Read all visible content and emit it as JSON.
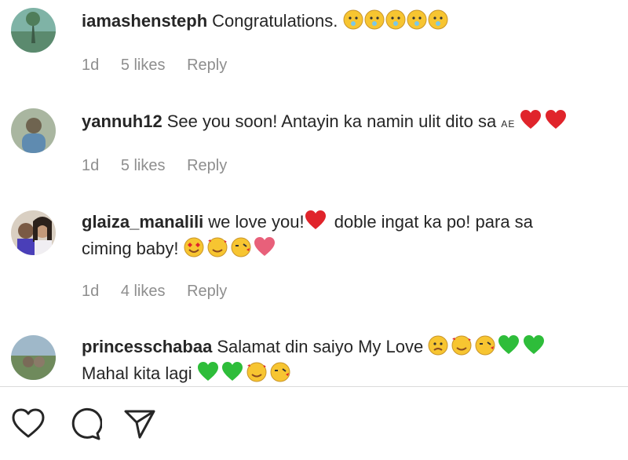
{
  "comments": [
    {
      "username": "iamashensteph",
      "text": "Congratulations.",
      "time": "1d",
      "likes": "5 likes",
      "reply": "Reply"
    },
    {
      "username": "yannuh12",
      "text": "See you soon! Antayin ka namin ulit dito sa",
      "small_text": "AE",
      "time": "1d",
      "likes": "5 likes",
      "reply": "Reply"
    },
    {
      "username": "glaiza_manalili",
      "text": "we love you!",
      "text2": "doble ingat ka po! para sa",
      "text3": "ciming baby!",
      "time": "1d",
      "likes": "4 likes",
      "reply": "Reply"
    },
    {
      "username": "princesschabaa",
      "text": "Salamat din saiyo My Love",
      "text2": "Mahal kita lagi"
    }
  ],
  "actions": {
    "like_icon": "heart-outline-icon",
    "comment_icon": "comment-bubble-icon",
    "share_icon": "paper-plane-icon"
  },
  "colors": {
    "text": "#262626",
    "meta": "#8e8e8e",
    "heart_red": "#e0242b",
    "heart_green": "#2ebd3a",
    "emoji_yellow": "#f7c531"
  }
}
